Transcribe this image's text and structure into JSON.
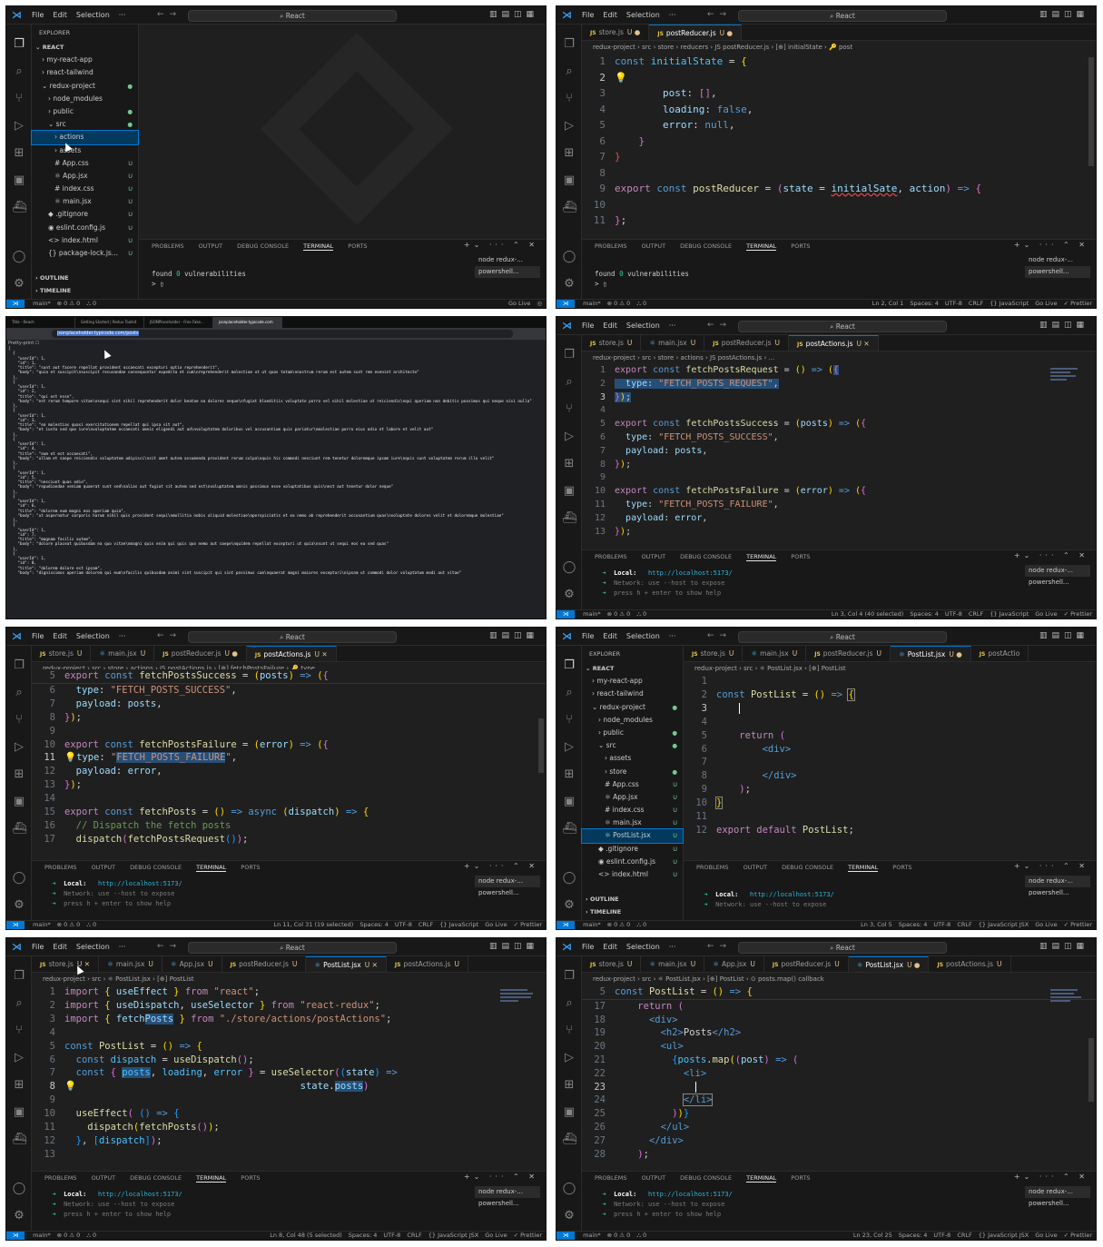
{
  "menu": {
    "file": "File",
    "edit": "Edit",
    "selection": "Selection",
    "more": "···",
    "project": "React"
  },
  "panel_tabs": [
    "PROBLEMS",
    "OUTPUT",
    "DEBUG CONSOLE",
    "TERMINAL",
    "PORTS"
  ],
  "terminals": {
    "node": "node redux-...",
    "powershell": "powershell..."
  },
  "status": {
    "branch": "main*",
    "errors": "⊗ 0 ⚠ 0",
    "ports": "⛬ 0",
    "golive": "Go Live",
    "prettier": "✓ Prettier",
    "spaces": "Spaces: 4",
    "encoding": "UTF-8",
    "eol": "CRLF",
    "lang_js": "{} JavaScript",
    "lang_jsx": "{} JavaScript JSX"
  },
  "term_text": {
    "found": "found ",
    "zero": "0",
    "vulns": " vulnerabilities",
    "prompt": "> ▯",
    "local_label": "Local:",
    "local_url": "http://localhost:5173/",
    "network": "Network: use --host to expose",
    "help": "press h + enter to show help"
  },
  "pane1": {
    "explorer_title": "EXPLORER",
    "section": "REACT",
    "tree": [
      {
        "label": "› my-react-app",
        "indent": 1,
        "badge": ""
      },
      {
        "label": "› react-tailwind",
        "indent": 1,
        "badge": ""
      },
      {
        "label": "⌄ redux-project",
        "indent": 1,
        "badge": "●"
      },
      {
        "label": "› node_modules",
        "indent": 2,
        "badge": ""
      },
      {
        "label": "› public",
        "indent": 2,
        "badge": "●"
      },
      {
        "label": "⌄ src",
        "indent": 2,
        "badge": "●"
      },
      {
        "label": "› actions",
        "indent": 3,
        "badge": ""
      },
      {
        "label": "› assets",
        "indent": 3,
        "badge": ""
      },
      {
        "label": "# App.css",
        "indent": 3,
        "badge": "U"
      },
      {
        "label": "⚛ App.jsx",
        "indent": 3,
        "badge": "U"
      },
      {
        "label": "# index.css",
        "indent": 3,
        "badge": "U"
      },
      {
        "label": "⚛ main.jsx",
        "indent": 3,
        "badge": "U"
      },
      {
        "label": "◆ .gitignore",
        "indent": 2,
        "badge": "U"
      },
      {
        "label": "◉ eslint.config.js",
        "indent": 2,
        "badge": "U"
      },
      {
        "label": "<> index.html",
        "indent": 2,
        "badge": "U"
      },
      {
        "label": "{} package-lock.js...",
        "indent": 2,
        "badge": "U"
      }
    ],
    "outline": "› OUTLINE",
    "timeline": "› TIMELINE"
  },
  "pane2": {
    "tabs": [
      {
        "label": "store.js",
        "mod": "U ●",
        "active": false
      },
      {
        "label": "postReducer.js",
        "mod": "U ●",
        "active": true
      }
    ],
    "breadcrumb": "redux-project › src › store › reducers › JS postReducer.js › [⊕] initialState › 🔑 post",
    "cursor": "Ln 2, Col 1"
  },
  "pane3": {
    "tabs": [
      "Title - Reach",
      "Getting Started | Redux Toolkit",
      "JSONPlaceholder - Free Fake...",
      "jsonplaceholder.typicode.com"
    ],
    "url": "jsonplaceholder.typicode.com/posts",
    "pretty_print": "Pretty-print ☐",
    "json": "[\n  {\n    \"userId\": 1,\n    \"id\": 1,\n    \"title\": \"sunt aut facere repellat provident occaecati excepturi optio reprehenderit\",\n    \"body\": \"quia et suscipit\\nsuscipit recusandae consequuntur expedita et cum\\nreprehenderit molestiae ut ut quas totam\\nnostrum rerum est autem sunt rem eveniet architecto\"\n  },\n  {\n    \"userId\": 1,\n    \"id\": 2,\n    \"title\": \"qui est esse\",\n    \"body\": \"est rerum tempore vitae\\nsequi sint nihil reprehenderit dolor beatae ea dolores neque\\nfugiat blanditiis voluptate porro vel nihil molestiae ut reiciendis\\nqui aperiam non debitis possimus qui neque nisi nulla\"\n  },\n  {\n    \"userId\": 1,\n    \"id\": 3,\n    \"title\": \"ea molestias quasi exercitationem repellat qui ipsa sit aut\",\n    \"body\": \"et iusto sed quo iure\\nvoluptatem occaecati omnis eligendi aut ad\\nvoluptatem doloribus vel accusantium quis pariatur\\nmolestiae porro eius odio et labore et velit aut\"\n  },\n  {\n    \"userId\": 1,\n    \"id\": 4,\n    \"title\": \"eum et est occaecati\",\n    \"body\": \"ullam et saepe reiciendis voluptatem adipisci\\nsit amet autem assumenda provident rerum culpa\\nquis hic commodi nesciunt rem tenetur doloremque ipsam iure\\nquis sunt voluptatem rerum illo velit\"\n  },\n  {\n    \"userId\": 1,\n    \"id\": 5,\n    \"title\": \"nesciunt quas odio\",\n    \"body\": \"repudiandae veniam quaerat sunt sed\\nalias aut fugiat sit autem sed est\\nvoluptatem omnis possimus esse voluptatibus quis\\nest aut tenetur dolor neque\"\n  },\n  {\n    \"userId\": 1,\n    \"id\": 6,\n    \"title\": \"dolorem eum magni eos aperiam quia\",\n    \"body\": \"ut aspernatur corporis harum nihil quis provident sequi\\nmollitia nobis aliquid molestiae\\nperspiciatis et ea nemo ab reprehenderit accusantium quas\\nvoluptate dolores velit et doloremque molestiae\"\n  },\n  {\n    \"userId\": 1,\n    \"id\": 7,\n    \"title\": \"magnam facilis autem\",\n    \"body\": \"dolore placeat quibusdam ea quo vitae\\nmagni quis enim qui quis quo nemo aut saepe\\nquidem repellat excepturi ut quia\\nsunt ut sequi eos ea sed quas\"\n  },\n  {\n    \"userId\": 1,\n    \"id\": 8,\n    \"title\": \"dolorem dolore est ipsam\",\n    \"body\": \"dignissimos aperiam dolorem qui eum\\nfacilis quibusdam animi sint suscipit qui sint possimus cum\\nquaerat magni maiores excepturi\\nipsam ut commodi dolor voluptatum modi aut vitae\""
  },
  "pane4": {
    "tabs": [
      {
        "label": "store.js",
        "mod": "U",
        "active": false
      },
      {
        "label": "main.jsx",
        "mod": "U",
        "active": false,
        "react": true
      },
      {
        "label": "postReducer.js",
        "mod": "U",
        "active": false
      },
      {
        "label": "postActions.js",
        "mod": "U ✕",
        "active": true
      }
    ],
    "breadcrumb": "redux-project › src › store › actions › JS postActions.js › ...",
    "cursor": "Ln 3, Col 4 (40 selected)"
  },
  "pane5": {
    "tabs": [
      {
        "label": "store.js",
        "mod": "U",
        "active": false
      },
      {
        "label": "main.jsx",
        "mod": "U",
        "active": false,
        "react": true
      },
      {
        "label": "postReducer.js",
        "mod": "U ●",
        "active": false
      },
      {
        "label": "postActions.js",
        "mod": "U ✕",
        "active": true
      }
    ],
    "breadcrumb": "redux-project › src › store › actions › JS postActions.js › [⊕] fetchPostsFailure › 🔑 type",
    "cursor": "Ln 11, Col 31 (19 selected)"
  },
  "pane6": {
    "explorer_title": "EXPLORER",
    "section": "REACT",
    "tree": [
      {
        "label": "› my-react-app",
        "indent": 1,
        "badge": ""
      },
      {
        "label": "› react-tailwind",
        "indent": 1,
        "badge": ""
      },
      {
        "label": "⌄ redux-project",
        "indent": 1,
        "badge": "●"
      },
      {
        "label": "› node_modules",
        "indent": 2,
        "badge": ""
      },
      {
        "label": "› public",
        "indent": 2,
        "badge": "●"
      },
      {
        "label": "⌄ src",
        "indent": 2,
        "badge": "●"
      },
      {
        "label": "› assets",
        "indent": 3,
        "badge": ""
      },
      {
        "label": "› store",
        "indent": 3,
        "badge": "●"
      },
      {
        "label": "# App.css",
        "indent": 3,
        "badge": "U"
      },
      {
        "label": "⚛ App.jsx",
        "indent": 3,
        "badge": "U"
      },
      {
        "label": "# index.css",
        "indent": 3,
        "badge": "U"
      },
      {
        "label": "⚛ main.jsx",
        "indent": 3,
        "badge": "U"
      },
      {
        "label": "⚛ PostList.jsx",
        "indent": 3,
        "badge": "U"
      },
      {
        "label": "◆ .gitignore",
        "indent": 2,
        "badge": "U"
      },
      {
        "label": "◉ eslint.config.js",
        "indent": 2,
        "badge": "U"
      },
      {
        "label": "<> index.html",
        "indent": 2,
        "badge": "U"
      }
    ],
    "outline": "› OUTLINE",
    "timeline": "› TIMELINE",
    "tabs": [
      {
        "label": "store.js",
        "mod": "U",
        "active": false
      },
      {
        "label": "main.jsx",
        "mod": "U",
        "active": false,
        "react": true
      },
      {
        "label": "postReducer.js",
        "mod": "U",
        "active": false
      },
      {
        "label": "PostList.jsx",
        "mod": "U ●",
        "active": true,
        "react": true
      },
      {
        "label": "postActio",
        "mod": "",
        "active": false
      }
    ],
    "breadcrumb": "redux-project › src › ⚛ PostList.jsx › [⊕] PostList",
    "cursor": "Ln 3, Col 5"
  },
  "pane7": {
    "tabs": [
      {
        "label": "store.js",
        "mod": "U ✕",
        "active": false
      },
      {
        "label": "main.jsx",
        "mod": "U",
        "active": false,
        "react": true
      },
      {
        "label": "App.jsx",
        "mod": "U",
        "active": false,
        "react": true
      },
      {
        "label": "postReducer.js",
        "mod": "U",
        "active": false
      },
      {
        "label": "PostList.jsx",
        "mod": "U ✕",
        "active": true,
        "react": true
      },
      {
        "label": "postActions.js",
        "mod": "U",
        "active": false
      }
    ],
    "breadcrumb": "redux-project › src › ⚛ PostList.jsx › [⊕] PostList",
    "cursor": "Ln 8, Col 48 (5 selected)"
  },
  "pane8": {
    "tabs": [
      {
        "label": "store.js",
        "mod": "U",
        "active": false
      },
      {
        "label": "main.jsx",
        "mod": "U",
        "active": false,
        "react": true
      },
      {
        "label": "App.jsx",
        "mod": "U",
        "active": false,
        "react": true
      },
      {
        "label": "postReducer.js",
        "mod": "U",
        "active": false
      },
      {
        "label": "PostList.jsx",
        "mod": "U ●",
        "active": true,
        "react": true
      },
      {
        "label": "postActions.js",
        "mod": "U",
        "active": false
      }
    ],
    "breadcrumb": "redux-project › src › ⚛ PostList.jsx › [⊕] PostList › ⊙ posts.map() callback",
    "cursor": "Ln 23, Col 25"
  }
}
